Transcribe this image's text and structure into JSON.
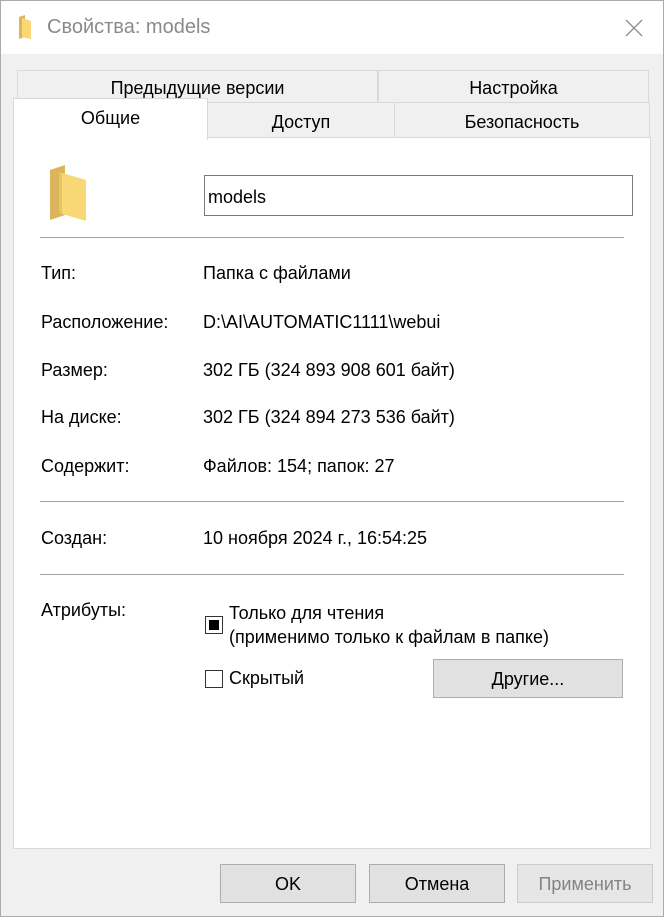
{
  "window": {
    "title": "Свойства: models",
    "title_color": "#8a8a8a",
    "folder_color": "#f8d775"
  },
  "tabs": {
    "row1": [
      "Предыдущие версии",
      "Настройка"
    ],
    "row2": [
      "Общие",
      "Доступ",
      "Безопасность"
    ],
    "active": "Общие"
  },
  "general": {
    "name_value": "models",
    "type_label": "Тип:",
    "type_value": "Папка с файлами",
    "location_label": "Расположение:",
    "location_value": "D:\\AI\\AUTOMATIC1111\\webui",
    "size_label": "Размер:",
    "size_value": "302 ГБ (324 893 908 601 байт)",
    "ondisk_label": "На диске:",
    "ondisk_value": "302 ГБ (324 894 273 536 байт)",
    "contains_label": "Содержит:",
    "contains_value": "Файлов: 154; папок: 27",
    "created_label": "Создан:",
    "created_value": "10 ноября 2024 г., 16:54:25",
    "attributes_label": "Атрибуты:",
    "readonly_line1": "Только для чтения",
    "readonly_line2": "(применимо только к файлам в папке)",
    "readonly_state": "indeterminate",
    "hidden_label": "Скрытый",
    "hidden_state": "unchecked",
    "other_button": "Другие..."
  },
  "buttons": {
    "ok": "OK",
    "cancel": "Отмена",
    "apply": "Применить",
    "apply_enabled": false
  }
}
